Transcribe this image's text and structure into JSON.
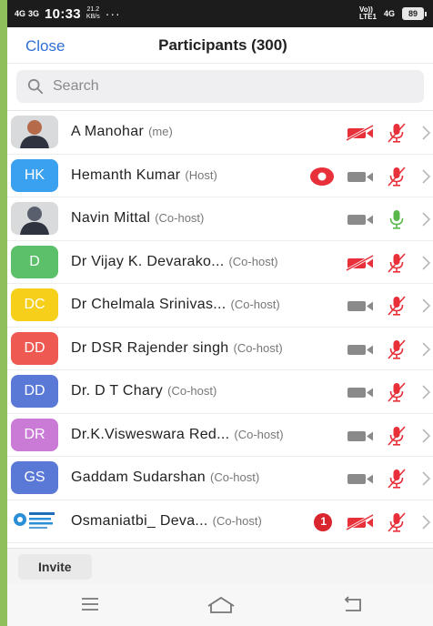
{
  "status_bar": {
    "network_left": "4G",
    "network_left2": "3G",
    "time": "10:33",
    "speed_value": "21.2",
    "speed_unit": "KB/s",
    "dots": "···",
    "volte": "Vo))",
    "lte": "LTE1",
    "network_right": "4G",
    "battery": "89"
  },
  "header": {
    "close_label": "Close",
    "title": "Participants (300)"
  },
  "search": {
    "placeholder": "Search"
  },
  "participants": [
    {
      "avatar_text": "",
      "avatar_type": "photo",
      "avatar_color": "#b56b4a",
      "name": "A Manohar",
      "role": "(me)",
      "video_on": false,
      "mic_on": false,
      "extra": "none"
    },
    {
      "avatar_text": "HK",
      "avatar_type": "initials",
      "avatar_color": "#3aa0f0",
      "name": "Hemanth Kumar",
      "role": "(Host)",
      "video_on": true,
      "mic_on": false,
      "extra": "record"
    },
    {
      "avatar_text": "",
      "avatar_type": "photo",
      "avatar_color": "#5a5f6e",
      "name": "Navin Mittal",
      "role": "(Co-host)",
      "video_on": true,
      "mic_on": true,
      "extra": "none"
    },
    {
      "avatar_text": "D",
      "avatar_type": "initials",
      "avatar_color": "#5cbf6a",
      "name": "Dr  Vijay K. Devarako...",
      "role": "(Co-host)",
      "video_on": false,
      "mic_on": false,
      "extra": "none"
    },
    {
      "avatar_text": "DC",
      "avatar_type": "initials",
      "avatar_color": "#f5cf1a",
      "name": "Dr Chelmala Srinivas...",
      "role": "(Co-host)",
      "video_on": true,
      "mic_on": false,
      "extra": "none"
    },
    {
      "avatar_text": "DD",
      "avatar_type": "initials",
      "avatar_color": "#ee5a52",
      "name": "Dr DSR Rajender singh",
      "role": "(Co-host)",
      "video_on": true,
      "mic_on": false,
      "extra": "none"
    },
    {
      "avatar_text": "DD",
      "avatar_type": "initials",
      "avatar_color": "#5a79d6",
      "name": "Dr. D T Chary",
      "role": "(Co-host)",
      "video_on": true,
      "mic_on": false,
      "extra": "none"
    },
    {
      "avatar_text": "DR",
      "avatar_type": "initials",
      "avatar_color": "#c97bd6",
      "name": "Dr.K.Visweswara Red...",
      "role": "(Co-host)",
      "video_on": true,
      "mic_on": false,
      "extra": "none"
    },
    {
      "avatar_text": "GS",
      "avatar_type": "initials",
      "avatar_color": "#5a79d6",
      "name": "Gaddam Sudarshan",
      "role": "(Co-host)",
      "video_on": true,
      "mic_on": false,
      "extra": "none"
    },
    {
      "avatar_text": "",
      "avatar_type": "logo",
      "avatar_color": "#ffffff",
      "name": "Osmaniatbi_ Deva...",
      "role": "(Co-host)",
      "video_on": false,
      "mic_on": false,
      "extra": "badge",
      "badge_count": "1",
      "logo_text": "Osmania Technology Business Incubator"
    }
  ],
  "footer": {
    "invite_label": "Invite"
  },
  "icons": {
    "search": "search-icon",
    "record": "record-icon",
    "video_on": "video-camera-icon",
    "video_off": "video-off-icon",
    "mic_on": "microphone-icon",
    "mic_off": "microphone-muted-icon",
    "chevron": "chevron-right-icon",
    "menu": "menu-icon",
    "home": "home-icon",
    "back": "back-icon"
  },
  "colors": {
    "accent": "#2d6fd6",
    "muted_red": "#e8303a",
    "mic_green": "#5ab84a",
    "camera_gray": "#8a8a8a"
  }
}
